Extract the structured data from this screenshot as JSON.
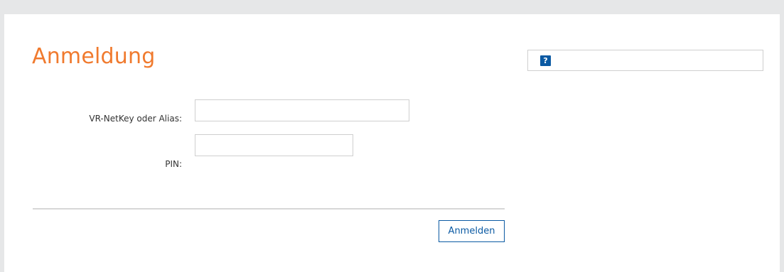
{
  "header": {
    "title": "Anmeldung"
  },
  "help": {
    "icon_name": "help-icon",
    "icon_glyph": "?",
    "accent_color": "#0b5aa3"
  },
  "form": {
    "netkey_label": "VR-NetKey oder Alias:",
    "netkey_value": "",
    "netkey_placeholder": "",
    "pin_label": "PIN:",
    "pin_value": "",
    "pin_placeholder": ""
  },
  "actions": {
    "login_label": "Anmelden"
  },
  "colors": {
    "title": "#f07a2e",
    "button": "#0b5aa3",
    "background": "#e6e7e8",
    "panel": "#ffffff"
  }
}
